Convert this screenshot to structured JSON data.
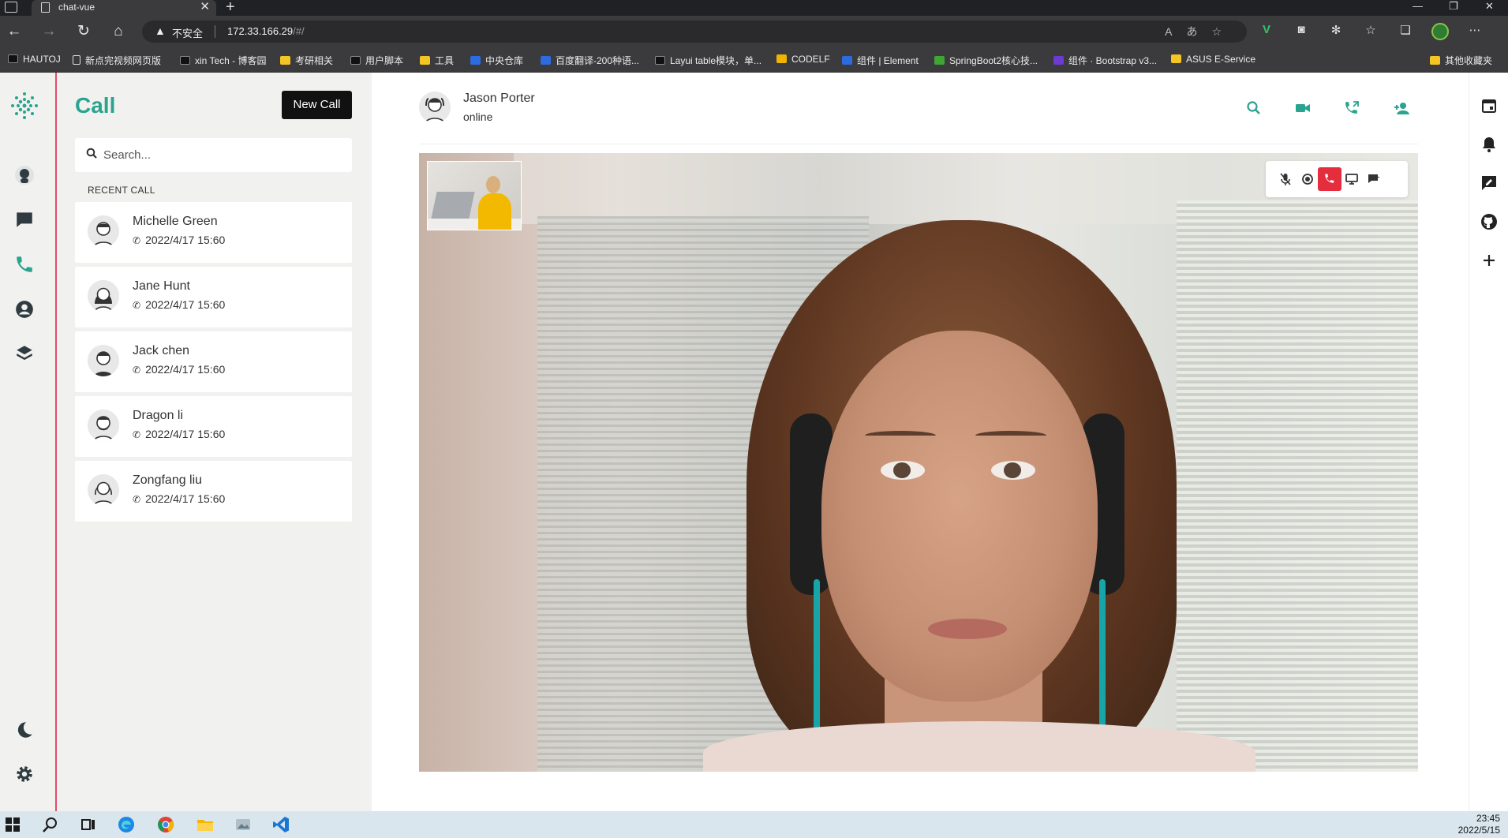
{
  "browser": {
    "tab_title": "chat-vue",
    "insecure_label": "不安全",
    "url_host": "172.33.166.29",
    "url_path": "/#/",
    "bookmarks": [
      "HAUTOJ",
      "新点完视频网页版",
      "xin Tech - 博客园",
      "考研相关",
      "用户脚本",
      "工具",
      "中央仓库",
      "百度翻译-200种语...",
      "Layui table模块，单...",
      "CODELF",
      "组件 | Element",
      "SpringBoot2核心技...",
      "组件 · Bootstrap v3...",
      "ASUS E-Service",
      "其他收藏夹"
    ]
  },
  "left_panel": {
    "title": "Call",
    "new_call_label": "New Call",
    "search_placeholder": "Search...",
    "section_label": "RECENT CALL",
    "calls": [
      {
        "name": "Michelle Green",
        "time": "2022/4/17 15:60"
      },
      {
        "name": "Jane Hunt",
        "time": "2022/4/17 15:60"
      },
      {
        "name": "Jack chen",
        "time": "2022/4/17 15:60"
      },
      {
        "name": "Dragon li",
        "time": "2022/4/17 15:60"
      },
      {
        "name": "Zongfang liu",
        "time": "2022/4/17 15:60"
      }
    ]
  },
  "chat_header": {
    "name": "Jason Porter",
    "status": "online"
  },
  "icons": {
    "rail": [
      "app-logo-icon",
      "avatar-icon",
      "chat-icon",
      "phone-icon",
      "user-icon",
      "layers-icon",
      "moon-icon",
      "gear-icon"
    ],
    "header_actions": [
      "search-icon",
      "video-camera-icon",
      "phone-forward-icon",
      "add-user-icon"
    ],
    "call_controls": [
      "mic-off-icon",
      "record-icon",
      "hang-up-icon",
      "screen-share-icon",
      "chat-bubble-icon"
    ],
    "right_rail": [
      "calendar-icon",
      "bell-icon",
      "message-edit-icon",
      "github-icon",
      "plus-icon"
    ]
  },
  "colors": {
    "accent": "#2aa38f",
    "hangup": "#e42d3d",
    "rail_border": "#e44b6b"
  },
  "taskbar": {
    "time": "23:45",
    "date": "2022/5/15"
  }
}
